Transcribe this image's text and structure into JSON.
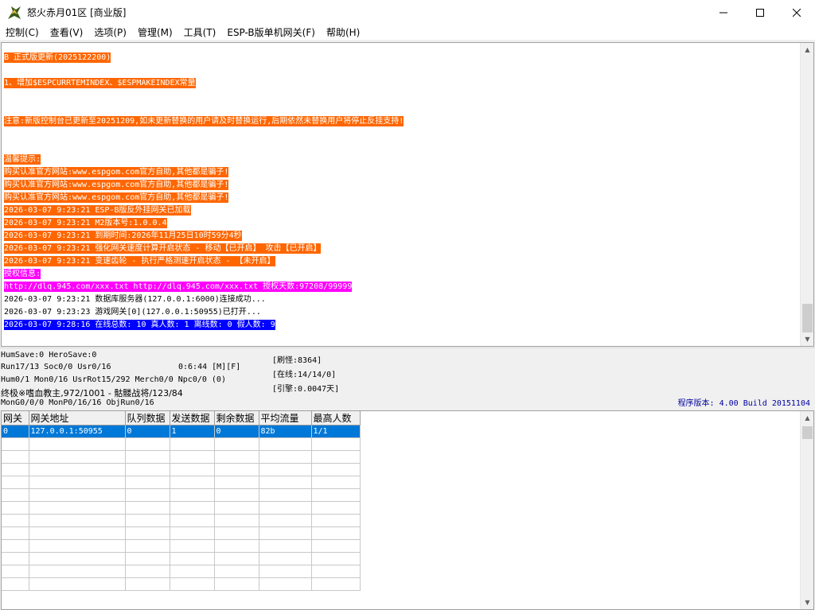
{
  "window": {
    "title": "怒火赤月01区 [商业版]"
  },
  "menu": [
    "控制(C)",
    "查看(V)",
    "选项(P)",
    "管理(M)",
    "工具(T)",
    "ESP-B版单机网关(F)",
    "帮助(H)"
  ],
  "log": [
    {
      "text": "B 正式版更新(2025122200)",
      "style": "orange"
    },
    {
      "text": "",
      "style": "none"
    },
    {
      "text": "1、增加$ESPCURRTEMINDEX、$ESPMAKEINDEX常量",
      "style": "orange"
    },
    {
      "text": "",
      "style": "none"
    },
    {
      "text": "",
      "style": "none"
    },
    {
      "text": "注意:新版控制台已更新至20251209,如未更新替换的用户请及时替换运行,后期依然未替换用户将停止反挂支持!",
      "style": "orange"
    },
    {
      "text": "",
      "style": "none"
    },
    {
      "text": "",
      "style": "none"
    },
    {
      "text": "温馨提示:",
      "style": "orange"
    },
    {
      "text": "购买认准官方网站:www.espgom.com官方自助,其他都是骗子!",
      "style": "orange"
    },
    {
      "text": "购买认准官方网站:www.espgom.com官方自助,其他都是骗子!",
      "style": "orange"
    },
    {
      "text": "购买认准官方网站:www.espgom.com官方自助,其他都是骗子!",
      "style": "orange"
    },
    {
      "text": "2026-03-07 9:23:21 ESP-B版反外挂网关已加载",
      "style": "orange"
    },
    {
      "text": "2026-03-07 9:23:21 M2版本号:1.0.0.4",
      "style": "orange"
    },
    {
      "text": "2026-03-07 9:23:21 到期时间:2026年11月25日10时59分4秒",
      "style": "orange"
    },
    {
      "text": "2026-03-07 9:23:21 强化网关速度计算开启状态 - 移动【已开启】 攻击【已开启】",
      "style": "orange"
    },
    {
      "text": "2026-03-07 9:23:21 变速齿轮 - 执行严格测速开启状态 - 【未开启】",
      "style": "orange"
    },
    {
      "text": "授权信息:",
      "style": "magenta"
    },
    {
      "text": "http://dlq.945.com/xxx.txt http://dlq.945.com/xxx.txt 授权天数:97208/99999",
      "style": "magenta"
    },
    {
      "text": "2026-03-07 9:23:21 数据库服务器(127.0.0.1:6000)连接成功...",
      "style": "none"
    },
    {
      "text": "2026-03-07 9:23:23 游戏网关[0](127.0.0.1:50955)已打开...",
      "style": "none"
    },
    {
      "text": "2026-03-07 9:28:16 在线总数: 10 真人数: 1 离线数: 0 假人数: 9",
      "style": "blue"
    }
  ],
  "status": {
    "line1": "HumSave:0 HeroSave:0",
    "line2": "Run17/13 Soc0/0 Usr0/16",
    "line2b": "0:6:44 [M][F]",
    "line3": "Hum0/1 Mon0/16 UsrRot15/292 Merch0/0 Npc0/0 (0)",
    "line4": "终极※嗜血教主,972/1001 - 骷髅战将/123/84",
    "line5": "MonG0/0/0 MonP0/16/16 ObjRun0/16",
    "box1": "[刷怪:8364]",
    "box2": "[在线:14/14/0]",
    "box3": "[引擎:0.0047天]",
    "version": "程序版本: 4.00 Build 20151104"
  },
  "grid": {
    "headers": [
      "网关",
      "网关地址",
      "队列数据",
      "发送数据",
      "剩余数据",
      "平均流量",
      "最高人数"
    ],
    "rows": [
      [
        "0",
        "127.0.0.1:50955",
        "0",
        "1",
        "0",
        "82b",
        "1/1"
      ]
    ]
  }
}
